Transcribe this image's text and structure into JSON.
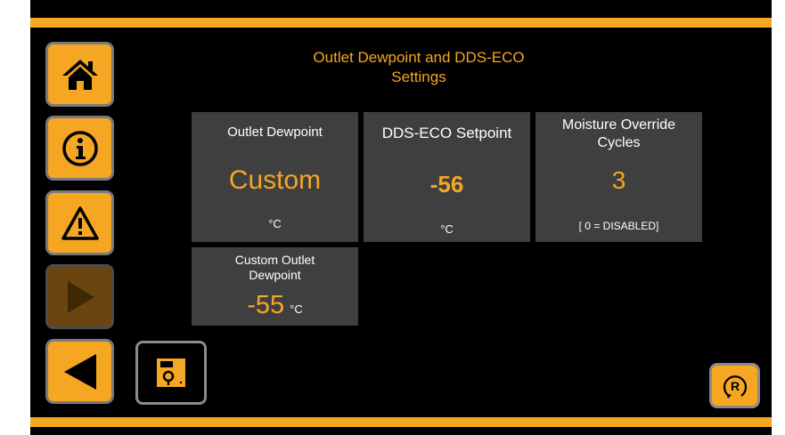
{
  "page": {
    "title_line1": "Outlet Dewpoint and DDS-ECO",
    "title_line2": "Settings"
  },
  "colors": {
    "accent": "#f5a623",
    "tile_bg": "#3f3f3f",
    "background": "#000000",
    "disabled_button": "#6b4510"
  },
  "nav": {
    "home_icon": "home-icon",
    "info_icon": "info-icon",
    "warning_icon": "warning-icon",
    "next_icon": "next-arrow-icon",
    "next_enabled": false,
    "back_icon": "back-arrow-icon",
    "save_icon": "save-icon",
    "reset_icon": "reset-icon",
    "reset_label": "R"
  },
  "tiles": {
    "outlet_dewpoint": {
      "label": "Outlet Dewpoint",
      "value": "Custom",
      "unit": "°C"
    },
    "eco_setpoint": {
      "label": "DDS-ECO Setpoint",
      "value": "-56",
      "unit": "°C"
    },
    "moisture_override": {
      "label_line1": "Moisture Override",
      "label_line2": "Cycles",
      "value": "3",
      "note": "[ 0 = DISABLED]"
    },
    "custom_outlet": {
      "label_line1": "Custom Outlet",
      "label_line2": "Dewpoint",
      "value": "-55",
      "unit": "°C"
    }
  }
}
